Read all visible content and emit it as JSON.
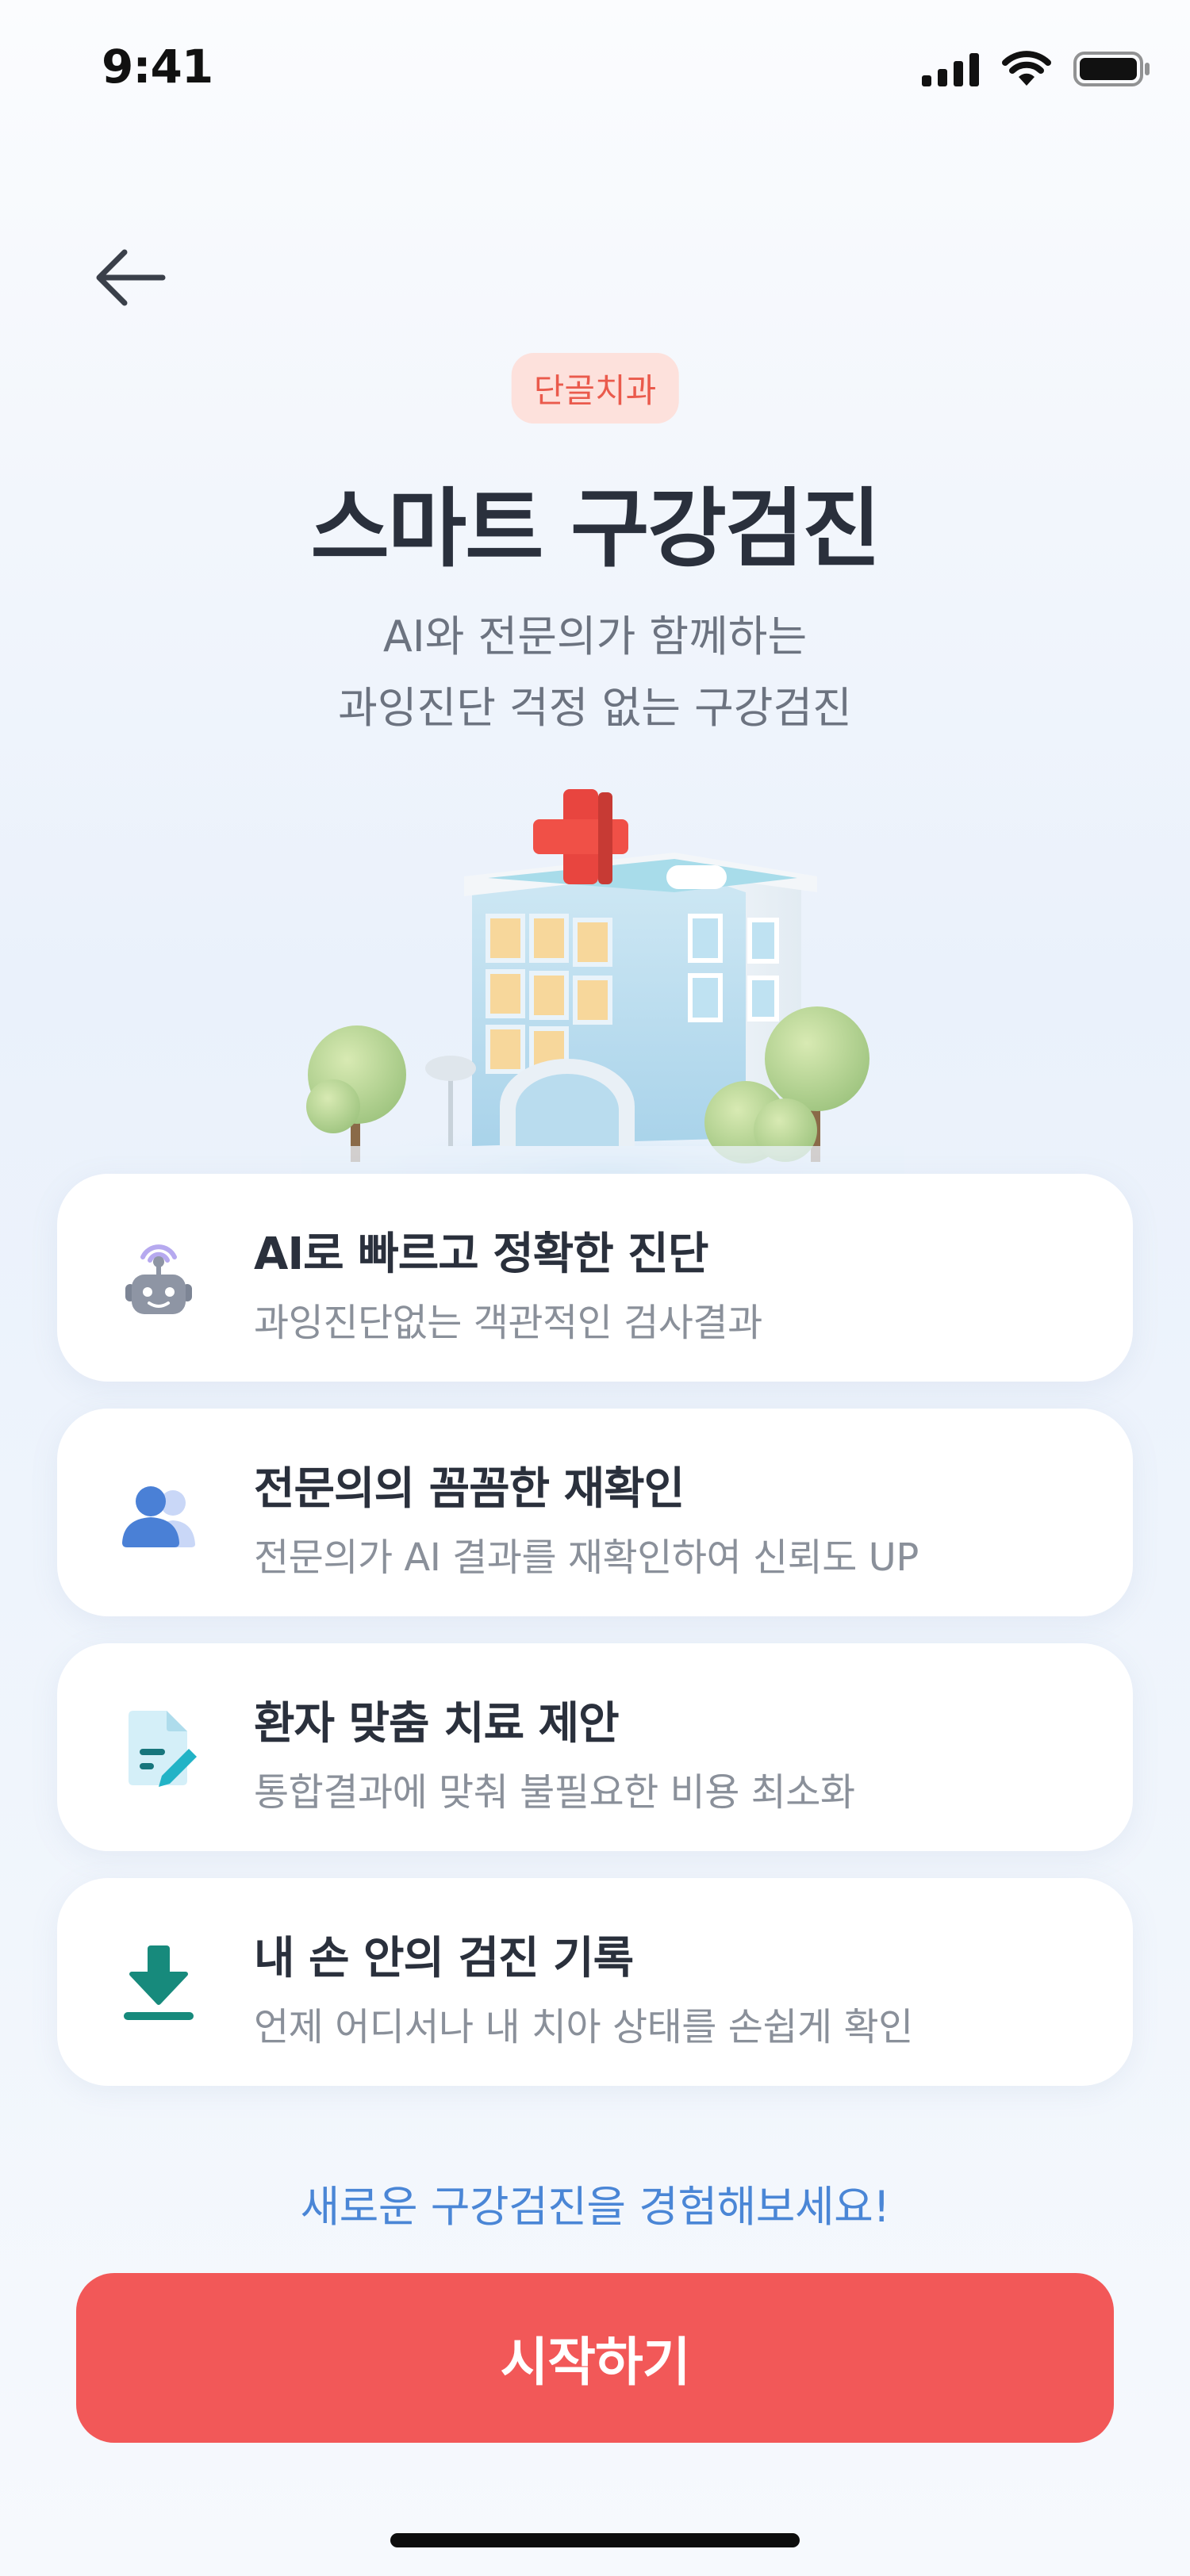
{
  "status_bar": {
    "time": "9:41"
  },
  "header": {
    "badge": "단골치과",
    "title": "스마트 구강검진",
    "subtitle_line1": "AI와 전문의가 함께하는",
    "subtitle_line2": "과잉진단 걱정 없는 구강검진"
  },
  "features": [
    {
      "icon": "robot-icon",
      "title": "AI로 빠르고 정확한 진단",
      "description": "과잉진단없는 객관적인 검사결과"
    },
    {
      "icon": "people-icon",
      "title": "전문의의 꼼꼼한 재확인",
      "description": "전문의가 AI 결과를 재확인하여 신뢰도 UP"
    },
    {
      "icon": "document-edit-icon",
      "title": "환자 맞춤 치료 제안",
      "description": "통합결과에 맞춰 불필요한 비용 최소화"
    },
    {
      "icon": "download-icon",
      "title": "내 손 안의 검진 기록",
      "description": "언제 어디서나 내 치아 상태를 손쉽게 확인"
    }
  ],
  "cta": {
    "prompt": "새로운 구강검진을 경험해보세요!",
    "button_label": "시작하기"
  },
  "colors": {
    "primary": "#f25858",
    "accent_blue": "#4a86d6",
    "badge_bg": "#fde1dc",
    "badge_text": "#ea5a4c"
  }
}
